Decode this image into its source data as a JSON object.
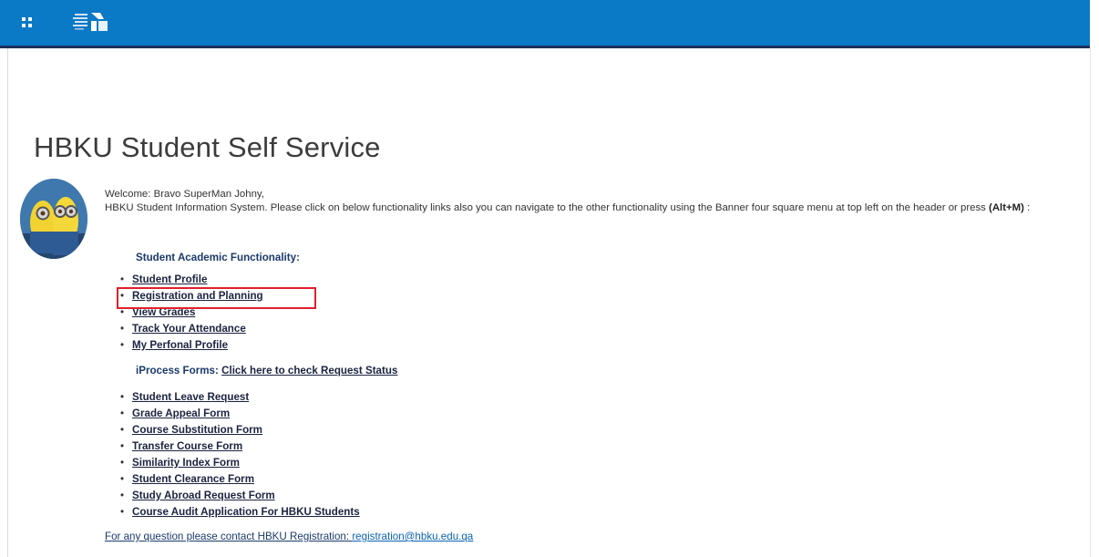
{
  "header": {
    "menu_icon": "grid-menu-icon",
    "logo_icon": "hbku-logo-icon",
    "bar_color": "#0a79c6",
    "bar_border_color": "#1c2f5a"
  },
  "page": {
    "title": "HBKU Student Self Service"
  },
  "welcome": {
    "line": "Welcome: Bravo SuperMan Johny,",
    "intro": "HBKU Student Information System. Please click on below functionality links also you can navigate to the other functionality using the Banner four square menu at top left on the header or press ",
    "shortcut": "(Alt+M)",
    "after_shortcut": " :"
  },
  "academic": {
    "heading": "Student Academic Functionality:",
    "items": [
      "Student Profile",
      "Registration and Planning",
      "View Grades",
      "Track Your Attendance",
      "My Perfonal Profile"
    ]
  },
  "iprocess": {
    "label": "iProcess Forms:",
    "link": "Click here to check Request Status",
    "items": [
      "Student Leave Request",
      "Grade Appeal Form",
      "Course Substitution Form",
      "Transfer Course Form",
      "Similarity Index Form",
      "Student Clearance Form",
      "Study Abroad Request Form",
      "Course Audit Application For HBKU Students"
    ]
  },
  "contact": {
    "text": "For any question please contact HBKU Registration: ",
    "email": "registration@hbku.edu.qa"
  },
  "highlight_color": "#e0202a"
}
